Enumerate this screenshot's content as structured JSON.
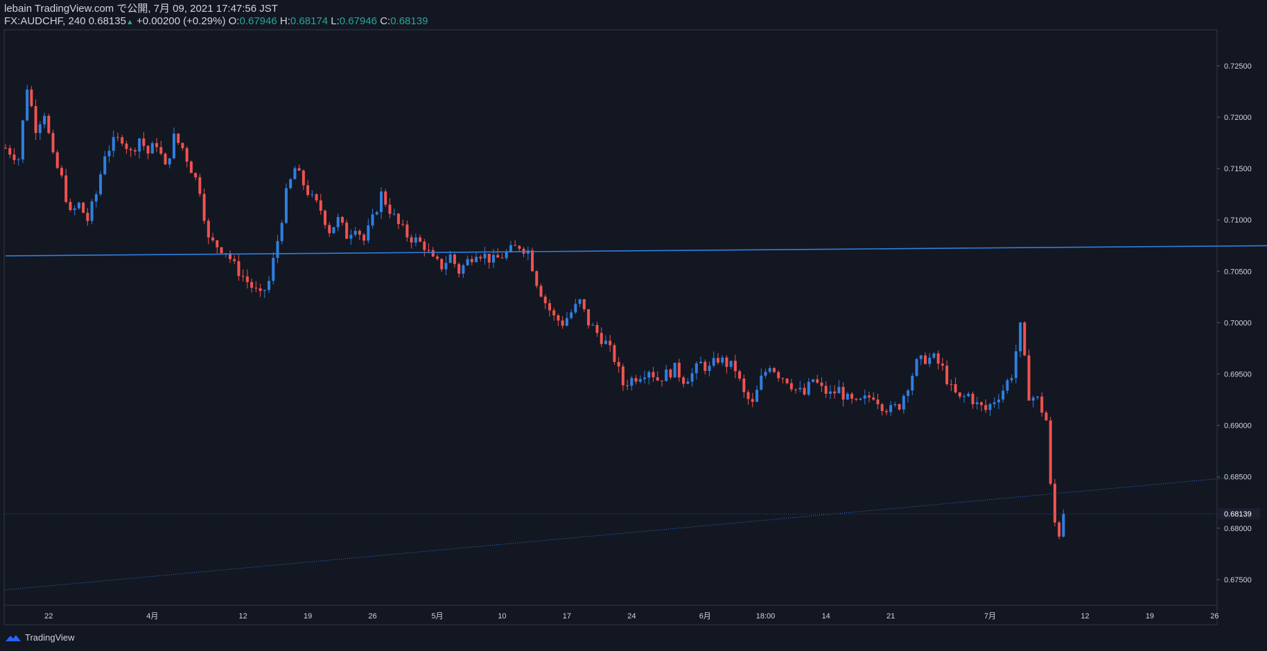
{
  "header": {
    "line1": "lebain TradingView.com で公開, 7月 09, 2021 17:47:56 JST",
    "symbol": "FX:AUDCHF, 240",
    "price": "0.68135",
    "change": "+0.00200 (+0.29%)",
    "o_label": "O:",
    "o_value": "0.67946",
    "h_label": "H:",
    "h_value": "0.68174",
    "l_label": "L:",
    "l_value": "0.67946",
    "c_label": "C:",
    "c_value": "0.68139"
  },
  "footer": {
    "brand": "TradingView"
  },
  "colors": {
    "background": "#131722",
    "up": "#2962ff",
    "up_light": "#2f7fe0",
    "down": "#ef5350",
    "trendline": "#2f7fe0",
    "text": "#d1d4dc",
    "teal": "#26a69a"
  },
  "chart_data": {
    "type": "candlestick",
    "symbol": "FX:AUDCHF",
    "timeframe": "240",
    "ylim": [
      0.6725,
      0.7285
    ],
    "last_price": 0.68139,
    "last_price_label": "0.68139",
    "y_ticks": [
      0.725,
      0.72,
      0.715,
      0.71,
      0.705,
      0.7,
      0.695,
      0.69,
      0.685,
      0.68,
      0.675
    ],
    "y_tick_labels": [
      "0.72500",
      "0.72000",
      "0.71500",
      "0.71000",
      "0.70500",
      "0.70000",
      "0.69500",
      "0.69000",
      "0.68500",
      "0.68000",
      "0.67500"
    ],
    "x_ticks": [
      {
        "label": "22",
        "bar": 10
      },
      {
        "label": "4月",
        "bar": 34
      },
      {
        "label": "12",
        "bar": 55
      },
      {
        "label": "19",
        "bar": 70
      },
      {
        "label": "26",
        "bar": 85
      },
      {
        "label": "5月",
        "bar": 100
      },
      {
        "label": "10",
        "bar": 115
      },
      {
        "label": "17",
        "bar": 130
      },
      {
        "label": "24",
        "bar": 145
      },
      {
        "label": "6月",
        "bar": 162
      },
      {
        "label": "18:00",
        "bar": 176
      },
      {
        "label": "14",
        "bar": 190
      },
      {
        "label": "21",
        "bar": 205
      },
      {
        "label": "7月",
        "bar": 228
      },
      {
        "label": "12",
        "bar": 250
      },
      {
        "label": "19",
        "bar": 265
      },
      {
        "label": "26",
        "bar": 280
      }
    ],
    "trendlines": [
      {
        "name": "upper",
        "style": "solid",
        "start": {
          "bar": 0,
          "price": 0.7065
        },
        "end": {
          "bar": 295,
          "price": 0.7075
        }
      },
      {
        "name": "lower",
        "style": "dotted",
        "start": {
          "bar": 0,
          "price": 0.674
        },
        "end": {
          "bar": 283,
          "price": 0.6849
        }
      }
    ],
    "close_path": [
      [
        0,
        0.717
      ],
      [
        3,
        0.716
      ],
      [
        5,
        0.723
      ],
      [
        7,
        0.719
      ],
      [
        9,
        0.7205
      ],
      [
        11,
        0.716
      ],
      [
        13,
        0.714
      ],
      [
        15,
        0.7105
      ],
      [
        17,
        0.7115
      ],
      [
        19,
        0.71
      ],
      [
        21,
        0.7125
      ],
      [
        23,
        0.7165
      ],
      [
        25,
        0.7175
      ],
      [
        27,
        0.718
      ],
      [
        29,
        0.7165
      ],
      [
        31,
        0.718
      ],
      [
        33,
        0.7165
      ],
      [
        35,
        0.7175
      ],
      [
        37,
        0.715
      ],
      [
        39,
        0.718
      ],
      [
        41,
        0.717
      ],
      [
        43,
        0.715
      ],
      [
        45,
        0.713
      ],
      [
        47,
        0.708
      ],
      [
        49,
        0.7075
      ],
      [
        51,
        0.707
      ],
      [
        53,
        0.7055
      ],
      [
        55,
        0.7045
      ],
      [
        57,
        0.7035
      ],
      [
        59,
        0.7025
      ],
      [
        61,
        0.704
      ],
      [
        63,
        0.708
      ],
      [
        65,
        0.7125
      ],
      [
        67,
        0.715
      ],
      [
        69,
        0.7135
      ],
      [
        71,
        0.712
      ],
      [
        73,
        0.711
      ],
      [
        75,
        0.709
      ],
      [
        77,
        0.71
      ],
      [
        79,
        0.7085
      ],
      [
        81,
        0.7095
      ],
      [
        83,
        0.708
      ],
      [
        85,
        0.71
      ],
      [
        87,
        0.7125
      ],
      [
        89,
        0.711
      ],
      [
        91,
        0.7095
      ],
      [
        93,
        0.7085
      ],
      [
        95,
        0.708
      ],
      [
        97,
        0.7075
      ],
      [
        99,
        0.706
      ],
      [
        101,
        0.7055
      ],
      [
        103,
        0.7065
      ],
      [
        105,
        0.705
      ],
      [
        107,
        0.706
      ],
      [
        109,
        0.707
      ],
      [
        111,
        0.7065
      ],
      [
        113,
        0.706
      ],
      [
        115,
        0.7065
      ],
      [
        117,
        0.707
      ],
      [
        119,
        0.7075
      ],
      [
        121,
        0.707
      ],
      [
        123,
        0.704
      ],
      [
        125,
        0.702
      ],
      [
        127,
        0.7005
      ],
      [
        129,
        0.7
      ],
      [
        131,
        0.701
      ],
      [
        133,
        0.702
      ],
      [
        135,
        0.7
      ],
      [
        137,
        0.699
      ],
      [
        139,
        0.698
      ],
      [
        141,
        0.6965
      ],
      [
        143,
        0.694
      ],
      [
        145,
        0.6945
      ],
      [
        147,
        0.695
      ],
      [
        149,
        0.6955
      ],
      [
        151,
        0.6945
      ],
      [
        153,
        0.695
      ],
      [
        155,
        0.6955
      ],
      [
        157,
        0.6945
      ],
      [
        159,
        0.695
      ],
      [
        161,
        0.696
      ],
      [
        163,
        0.6955
      ],
      [
        165,
        0.6965
      ],
      [
        167,
        0.696
      ],
      [
        169,
        0.6955
      ],
      [
        171,
        0.693
      ],
      [
        173,
        0.692
      ],
      [
        175,
        0.6945
      ],
      [
        177,
        0.696
      ],
      [
        179,
        0.695
      ],
      [
        181,
        0.6945
      ],
      [
        183,
        0.6935
      ],
      [
        185,
        0.693
      ],
      [
        187,
        0.6945
      ],
      [
        189,
        0.6935
      ],
      [
        191,
        0.693
      ],
      [
        193,
        0.6935
      ],
      [
        195,
        0.6925
      ],
      [
        197,
        0.692
      ],
      [
        199,
        0.6925
      ],
      [
        201,
        0.693
      ],
      [
        203,
        0.692
      ],
      [
        205,
        0.6915
      ],
      [
        207,
        0.692
      ],
      [
        209,
        0.694
      ],
      [
        211,
        0.696
      ],
      [
        213,
        0.6965
      ],
      [
        215,
        0.6965
      ],
      [
        217,
        0.6955
      ],
      [
        219,
        0.6935
      ],
      [
        221,
        0.6925
      ],
      [
        223,
        0.693
      ],
      [
        225,
        0.692
      ],
      [
        227,
        0.6915
      ],
      [
        229,
        0.6925
      ],
      [
        231,
        0.6935
      ],
      [
        233,
        0.695
      ],
      [
        235,
        0.6995
      ],
      [
        237,
        0.693
      ],
      [
        239,
        0.6925
      ],
      [
        241,
        0.6905
      ],
      [
        242,
        0.684
      ],
      [
        243,
        0.6805
      ],
      [
        244,
        0.6795
      ],
      [
        245,
        0.681
      ]
    ],
    "candle_count": 246
  }
}
